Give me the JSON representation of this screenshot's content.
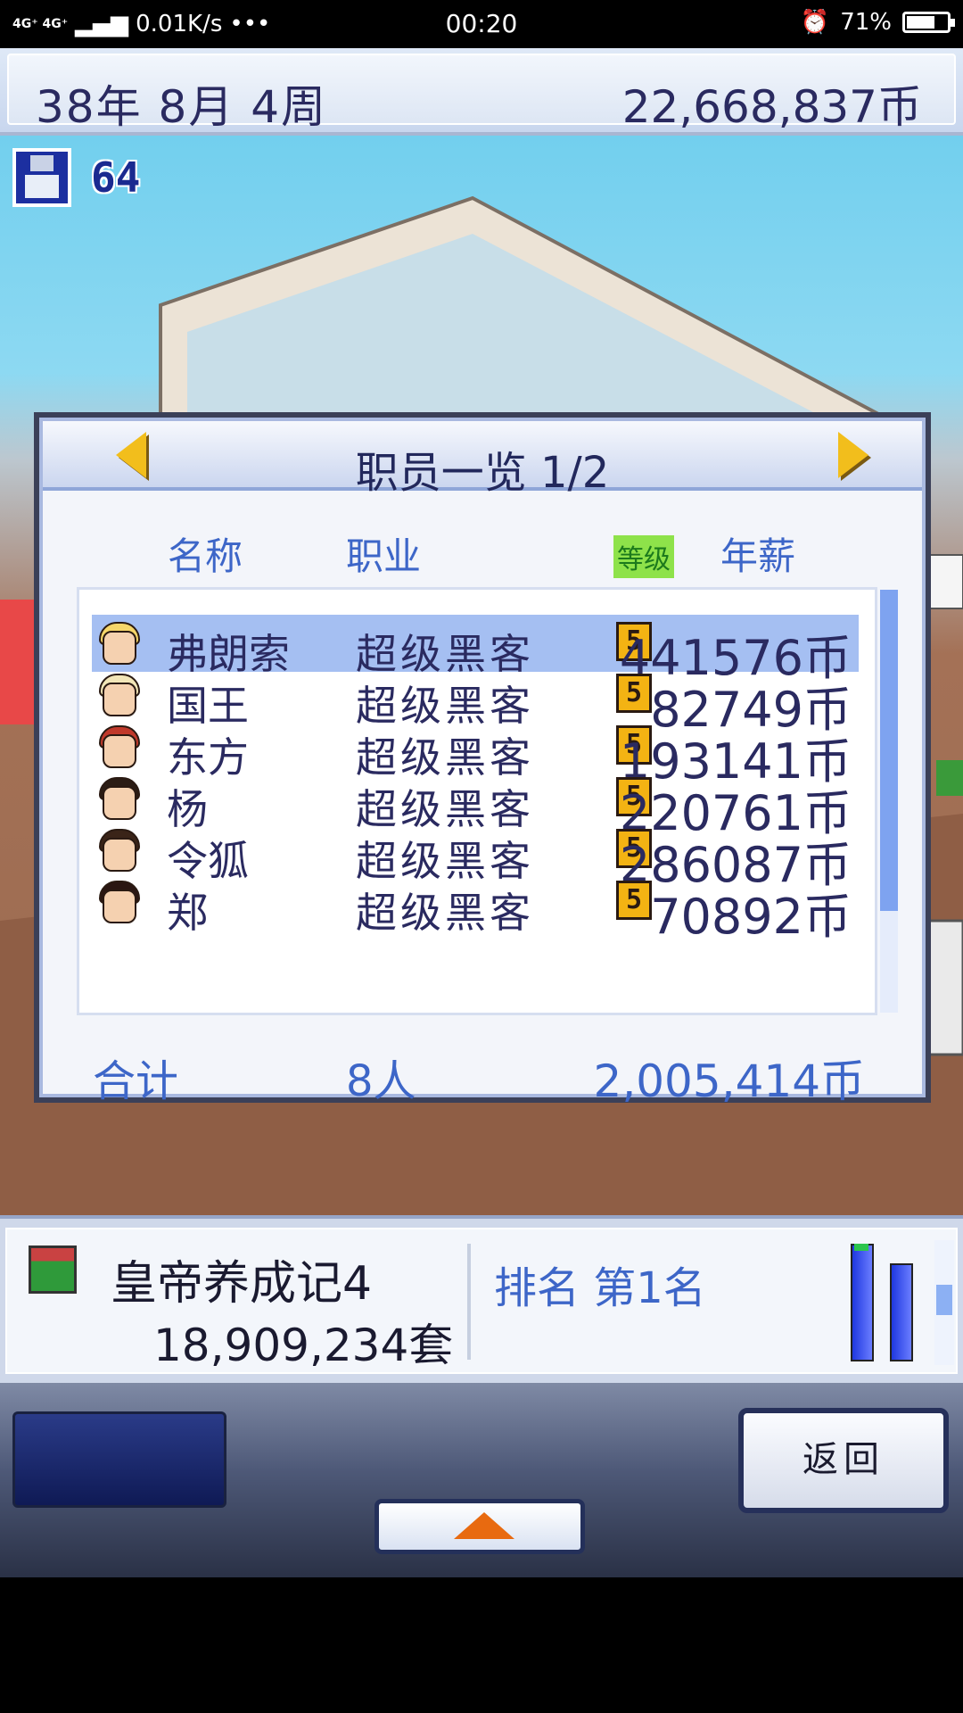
{
  "status_bar": {
    "network": "4G⁺ 4G⁺",
    "speed": "0.01K/s",
    "dots": "•••",
    "time": "00:20",
    "battery_percent": "71%",
    "battery_level": 0.71
  },
  "top_bar": {
    "date": "38年 8月 4周",
    "money": "22,668,837币"
  },
  "save": {
    "count": "64"
  },
  "dialog": {
    "title": "职员一览 1/2",
    "columns": {
      "name": "名称",
      "job": "职业",
      "level": "等级",
      "salary": "年薪"
    },
    "rows": [
      {
        "name": "弗朗索",
        "job": "超级黑客",
        "level": "5",
        "salary": "441576币",
        "selected": true
      },
      {
        "name": "国王",
        "job": "超级黑客",
        "level": "5",
        "salary": "82749币"
      },
      {
        "name": "东方",
        "job": "超级黑客",
        "level": "5",
        "salary": "193141币"
      },
      {
        "name": "杨",
        "job": "超级黑客",
        "level": "5",
        "salary": "220761币"
      },
      {
        "name": "令狐",
        "job": "超级黑客",
        "level": "5",
        "salary": "286087币"
      },
      {
        "name": "郑",
        "job": "超级黑客",
        "level": "5",
        "salary": "70892币"
      }
    ],
    "total": {
      "label": "合计",
      "count": "8人",
      "salary": "2,005,414币"
    }
  },
  "game_info": {
    "title": "皇帝养成记4",
    "sales": "18,909,234套",
    "rank": "排名 第1名"
  },
  "controls": {
    "back_label": "返回"
  }
}
